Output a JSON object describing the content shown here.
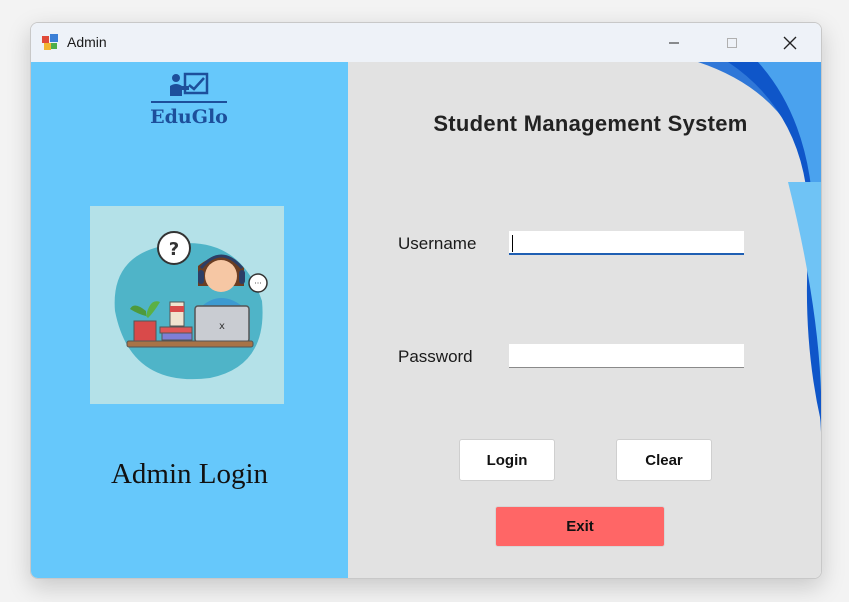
{
  "window": {
    "title": "Admin",
    "controls": {
      "minimize": "minimize",
      "maximize": "maximize",
      "close": "close"
    }
  },
  "sidebar": {
    "logo_text": "EduGlo",
    "caption": "Admin Login",
    "background": "#66c8fb",
    "illustration_background": "#b4e1e8"
  },
  "form": {
    "title": "Student Management System",
    "username_label": "Username",
    "username_value": "",
    "password_label": "Password",
    "password_value": "",
    "login_label": "Login",
    "clear_label": "Clear",
    "exit_label": "Exit",
    "exit_color": "#ff6666",
    "background": "#e2e2e2"
  },
  "icons": {
    "app": "app-icon",
    "logo": "teacher-board-icon",
    "illustration": "support-agent-illustration"
  }
}
